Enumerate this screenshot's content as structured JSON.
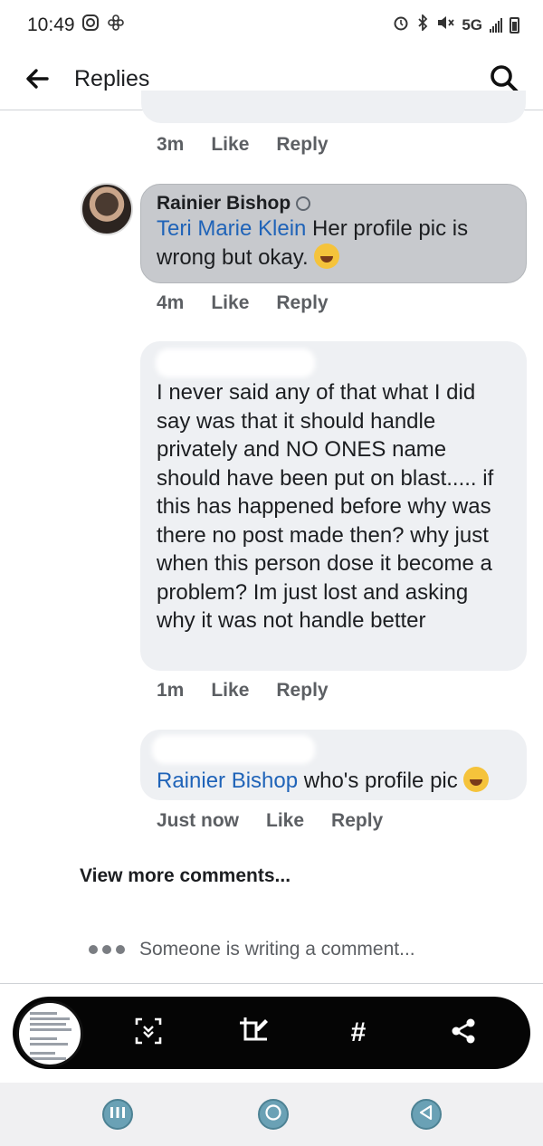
{
  "status_bar": {
    "time": "10:49",
    "network": "5G"
  },
  "header": {
    "title": "Replies"
  },
  "comments": [
    {
      "meta": {
        "time": "3m",
        "like": "Like",
        "reply": "Reply"
      }
    },
    {
      "author": "Rainier Bishop",
      "mention": "Teri Marie Klein",
      "text": " Her profile pic is wrong but okay. ",
      "meta": {
        "time": "4m",
        "like": "Like",
        "reply": "Reply"
      }
    },
    {
      "text": "I never said any of that what I did say was that it should handle privately and NO ONES name should have been put on blast..... if this has happened before  why was there no post made then? why just when this person dose it become a problem? Im just lost and asking why it was not handle better",
      "meta": {
        "time": "1m",
        "like": "Like",
        "reply": "Reply"
      }
    },
    {
      "mention": "Rainier Bishop",
      "text": " who's profile pic ",
      "meta": {
        "time": "Just now",
        "like": "Like",
        "reply": "Reply"
      }
    }
  ],
  "view_more": "View more comments...",
  "typing_indicator": "Someone is writing a comment...",
  "toolbar": {
    "hashtag": "#"
  },
  "colors": {
    "mention": "#1f63b8",
    "bubble": "#eef0f3",
    "toolbar": "#050505",
    "nav_button": "#6aa1b5"
  }
}
